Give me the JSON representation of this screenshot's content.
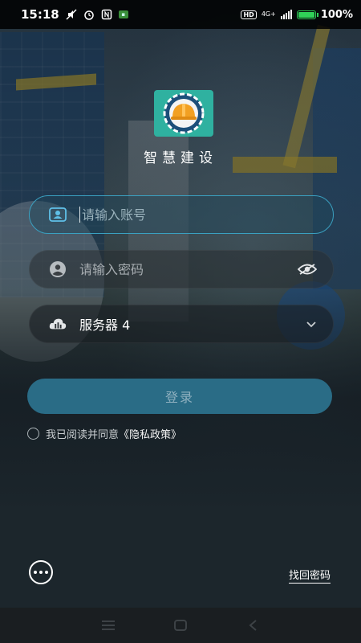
{
  "status_bar": {
    "time": "15:18",
    "hd": "HD",
    "network": "4G+",
    "battery_percent_label": "100%",
    "battery_level": 1.0
  },
  "app": {
    "title": "智慧建设",
    "logo_icon": "construction-helmet-gear-icon"
  },
  "login_form": {
    "account_placeholder": "请输入账号",
    "password_placeholder": "请输入密码",
    "server_value": "服务器 4",
    "login_label": "登录"
  },
  "agreement": {
    "prefix": "我已阅读并同意",
    "policy_link": "《隐私政策》"
  },
  "footer": {
    "forgot_password": "找回密码"
  },
  "colors": {
    "accent": "#2a6c86",
    "account_border": "#3aa0c0",
    "logo_bg": "#2fb1a0",
    "battery": "#30d158"
  }
}
